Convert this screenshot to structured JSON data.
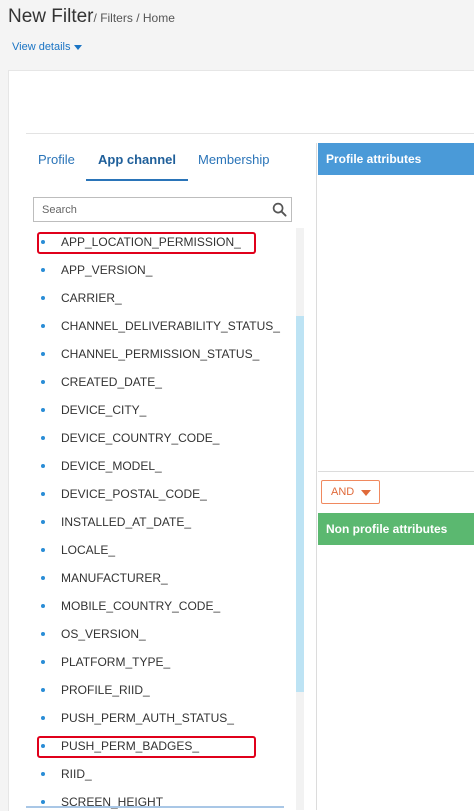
{
  "header": {
    "title": "New Filter",
    "breadcrumb": [
      "Filters",
      "Home"
    ],
    "view_details": "View details"
  },
  "tabs": [
    {
      "label": "Profile",
      "active": false
    },
    {
      "label": "App channel",
      "active": true
    },
    {
      "label": "Membership",
      "active": false
    }
  ],
  "search": {
    "placeholder": "Search",
    "value": ""
  },
  "attributes": [
    {
      "label": "APP_LOCATION_PERMISSION_",
      "highlighted": true
    },
    {
      "label": "APP_VERSION_",
      "highlighted": false
    },
    {
      "label": "CARRIER_",
      "highlighted": false
    },
    {
      "label": "CHANNEL_DELIVERABILITY_STATUS_",
      "highlighted": false
    },
    {
      "label": "CHANNEL_PERMISSION_STATUS_",
      "highlighted": false
    },
    {
      "label": "CREATED_DATE_",
      "highlighted": false
    },
    {
      "label": "DEVICE_CITY_",
      "highlighted": false
    },
    {
      "label": "DEVICE_COUNTRY_CODE_",
      "highlighted": false
    },
    {
      "label": "DEVICE_MODEL_",
      "highlighted": false
    },
    {
      "label": "DEVICE_POSTAL_CODE_",
      "highlighted": false
    },
    {
      "label": "INSTALLED_AT_DATE_",
      "highlighted": false
    },
    {
      "label": "LOCALE_",
      "highlighted": false
    },
    {
      "label": "MANUFACTURER_",
      "highlighted": false
    },
    {
      "label": "MOBILE_COUNTRY_CODE_",
      "highlighted": false
    },
    {
      "label": "OS_VERSION_",
      "highlighted": false
    },
    {
      "label": "PLATFORM_TYPE_",
      "highlighted": false
    },
    {
      "label": "PROFILE_RIID_",
      "highlighted": false
    },
    {
      "label": "PUSH_PERM_AUTH_STATUS_",
      "highlighted": false
    },
    {
      "label": "PUSH_PERM_BADGES_",
      "highlighted": true
    },
    {
      "label": "RIID_",
      "highlighted": false
    },
    {
      "label": "SCREEN_HEIGHT",
      "highlighted": false
    }
  ],
  "panels": {
    "profile_attributes": "Profile attributes",
    "and_button": "AND",
    "non_profile_attributes": "Non profile attributes"
  },
  "colors": {
    "link": "#1a74c4",
    "profile_header": "#4a9ad8",
    "non_profile_header": "#5bb870",
    "and_button": "#e06a3a",
    "highlight_box": "#e0001b"
  },
  "icons": {
    "search": "search-icon",
    "view_details_caret": "caret-down-icon",
    "and_caret": "caret-down-icon",
    "list_bullet": "bullet-icon"
  }
}
